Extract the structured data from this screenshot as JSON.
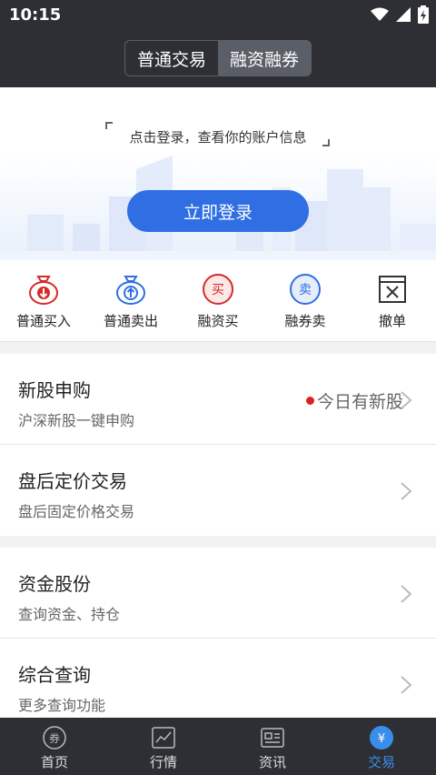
{
  "status_bar": {
    "time": "10:15"
  },
  "header": {
    "segments": [
      {
        "label": "普通交易",
        "active": false
      },
      {
        "label": "融资融券",
        "active": true
      }
    ]
  },
  "hero": {
    "prompt": "点击登录，查看你的账户信息",
    "login_button": "立即登录"
  },
  "quick_actions": [
    {
      "label": "普通买入",
      "icon": "buy-bag-icon"
    },
    {
      "label": "普通卖出",
      "icon": "sell-bag-icon"
    },
    {
      "label": "融资买",
      "icon": "margin-buy-icon",
      "glyph": "买"
    },
    {
      "label": "融券卖",
      "icon": "short-sell-icon",
      "glyph": "卖"
    },
    {
      "label": "撤单",
      "icon": "cancel-order-icon"
    }
  ],
  "list1": [
    {
      "title": "新股申购",
      "sub": "沪深新股一键申购",
      "extra": "今日有新股"
    },
    {
      "title": "盘后定价交易",
      "sub": "盘后固定价格交易"
    }
  ],
  "list2": [
    {
      "title": "资金股份",
      "sub": "查询资金、持仓"
    },
    {
      "title": "综合查询",
      "sub": "更多查询功能"
    }
  ],
  "tabbar": [
    {
      "label": "首页",
      "icon": "home-coin-icon",
      "glyph": "券",
      "active": false
    },
    {
      "label": "行情",
      "icon": "market-chart-icon",
      "active": false
    },
    {
      "label": "资讯",
      "icon": "news-icon",
      "active": false
    },
    {
      "label": "交易",
      "icon": "trade-yen-icon",
      "glyph": "¥",
      "active": true
    }
  ],
  "colors": {
    "accent": "#2f6fe3",
    "dark_bar": "#2d2f35",
    "red": "#e02020",
    "tab_active": "#3a8dea"
  }
}
